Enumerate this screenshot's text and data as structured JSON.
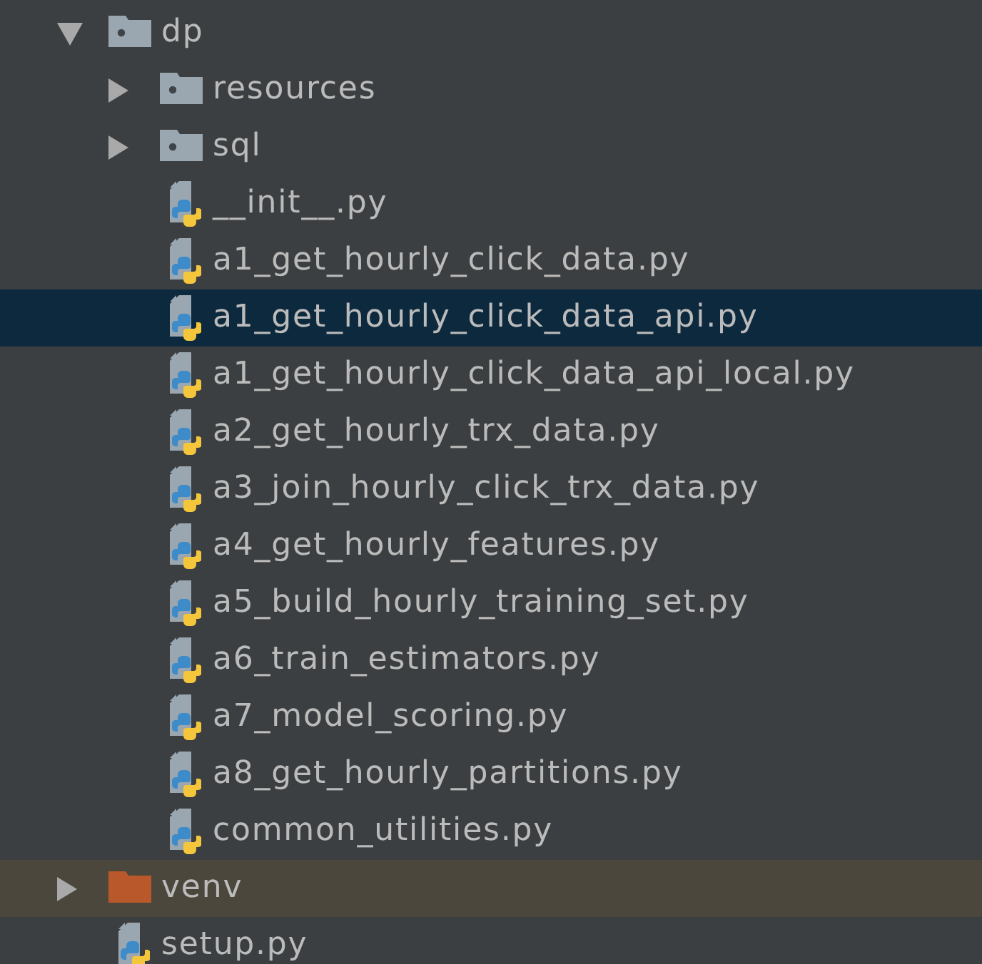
{
  "tree": [
    {
      "kind": "folder",
      "name": "dp",
      "expanded": true,
      "selected": false,
      "highlighted": false,
      "children": [
        {
          "kind": "folder",
          "name": "resources",
          "expanded": false,
          "selected": false,
          "highlighted": false
        },
        {
          "kind": "folder",
          "name": "sql",
          "expanded": false,
          "selected": false,
          "highlighted": false
        },
        {
          "kind": "python_file",
          "name": "__init__.py",
          "selected": false,
          "highlighted": false
        },
        {
          "kind": "python_file",
          "name": "a1_get_hourly_click_data.py",
          "selected": false,
          "highlighted": false
        },
        {
          "kind": "python_file",
          "name": "a1_get_hourly_click_data_api.py",
          "selected": true,
          "highlighted": false
        },
        {
          "kind": "python_file",
          "name": "a1_get_hourly_click_data_api_local.py",
          "selected": false,
          "highlighted": false
        },
        {
          "kind": "python_file",
          "name": "a2_get_hourly_trx_data.py",
          "selected": false,
          "highlighted": false
        },
        {
          "kind": "python_file",
          "name": "a3_join_hourly_click_trx_data.py",
          "selected": false,
          "highlighted": false
        },
        {
          "kind": "python_file",
          "name": "a4_get_hourly_features.py",
          "selected": false,
          "highlighted": false
        },
        {
          "kind": "python_file",
          "name": "a5_build_hourly_training_set.py",
          "selected": false,
          "highlighted": false
        },
        {
          "kind": "python_file",
          "name": "a6_train_estimators.py",
          "selected": false,
          "highlighted": false
        },
        {
          "kind": "python_file",
          "name": "a7_model_scoring.py",
          "selected": false,
          "highlighted": false
        },
        {
          "kind": "python_file",
          "name": "a8_get_hourly_partitions.py",
          "selected": false,
          "highlighted": false
        },
        {
          "kind": "python_file",
          "name": "common_utilities.py",
          "selected": false,
          "highlighted": false
        }
      ]
    },
    {
      "kind": "excluded_folder",
      "name": "venv",
      "expanded": false,
      "selected": false,
      "highlighted": true
    },
    {
      "kind": "python_file",
      "name": "setup.py",
      "selected": false,
      "highlighted": false
    }
  ]
}
